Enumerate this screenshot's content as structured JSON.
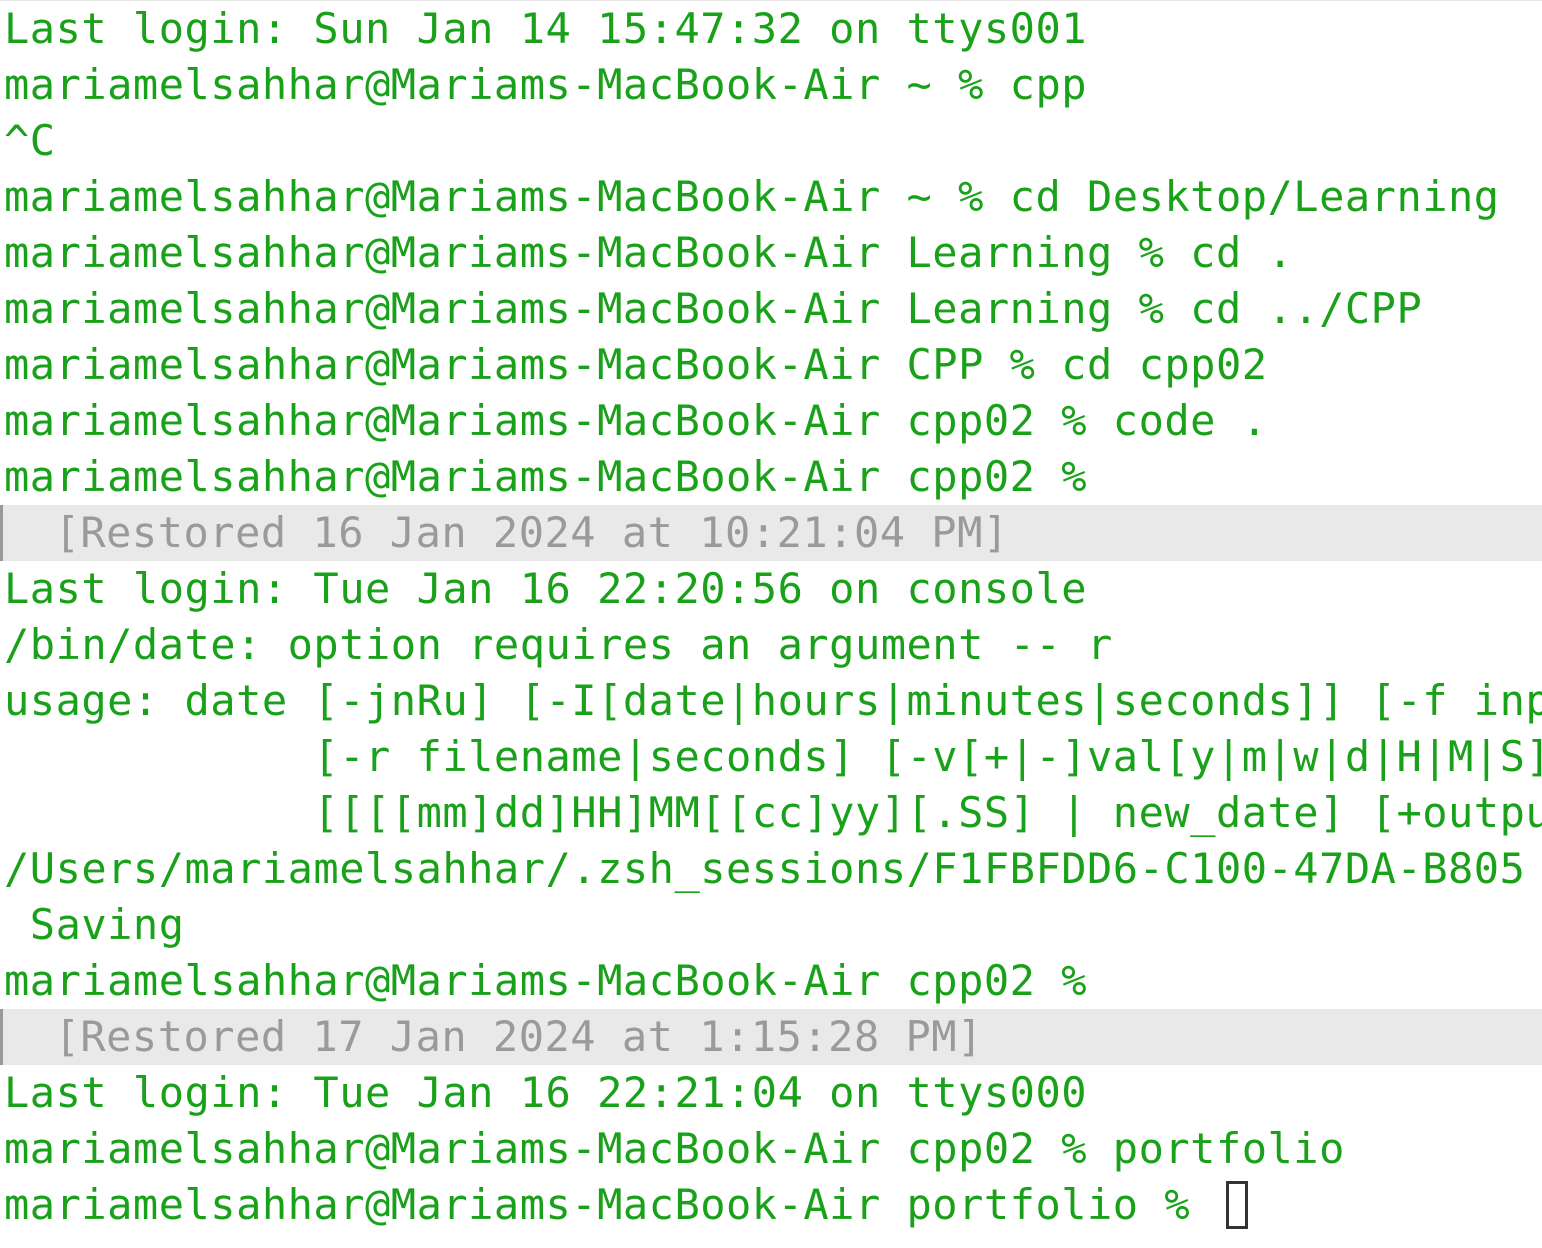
{
  "terminal": {
    "lines": [
      {
        "text": "Last login: Sun Jan 14 15:47:32 on ttys001"
      },
      {
        "text": "mariamelsahhar@Mariams-MacBook-Air ~ % cpp"
      },
      {
        "text": "^C"
      },
      {
        "text": "mariamelsahhar@Mariams-MacBook-Air ~ % cd Desktop/Learning"
      },
      {
        "text": "mariamelsahhar@Mariams-MacBook-Air Learning % cd ."
      },
      {
        "text": "mariamelsahhar@Mariams-MacBook-Air Learning % cd ../CPP"
      },
      {
        "text": "mariamelsahhar@Mariams-MacBook-Air CPP % cd cpp02"
      },
      {
        "text": "mariamelsahhar@Mariams-MacBook-Air cpp02 % code ."
      },
      {
        "text": "mariamelsahhar@Mariams-MacBook-Air cpp02 %"
      },
      {
        "text": "  [Restored 16 Jan 2024 at 10:21:04 PM]"
      },
      {
        "text": "Last login: Tue Jan 16 22:20:56 on console"
      },
      {
        "text": "/bin/date: option requires an argument -- r"
      },
      {
        "text": "usage: date [-jnRu] [-I[date|hours|minutes|seconds]] [-f input_fmt]"
      },
      {
        "text": "            [-r filename|seconds] [-v[+|-]val[y|m|w|d|H|M|S]]"
      },
      {
        "text": "            [[[[mm]dd]HH]MM[[cc]yy][.SS] | new_date] [+output_fmt]"
      },
      {
        "text": "/Users/mariamelsahhar/.zsh_sessions/F1FBFDD6-C100-47DA-B805"
      },
      {
        "text": " Saving"
      },
      {
        "text": "mariamelsahhar@Mariams-MacBook-Air cpp02 %"
      },
      {
        "text": "  [Restored 17 Jan 2024 at 1:15:28 PM]"
      },
      {
        "text": "Last login: Tue Jan 16 22:21:04 on ttys000"
      },
      {
        "text": "mariamelsahhar@Mariams-MacBook-Air cpp02 % portfolio"
      },
      {
        "text": "mariamelsahhar@Mariams-MacBook-Air portfolio % "
      }
    ],
    "colors": {
      "text": "#1aa11a",
      "background": "#ffffff",
      "restored_bar": "#e9e9e9",
      "restored_text": "#9a9a9a"
    }
  }
}
